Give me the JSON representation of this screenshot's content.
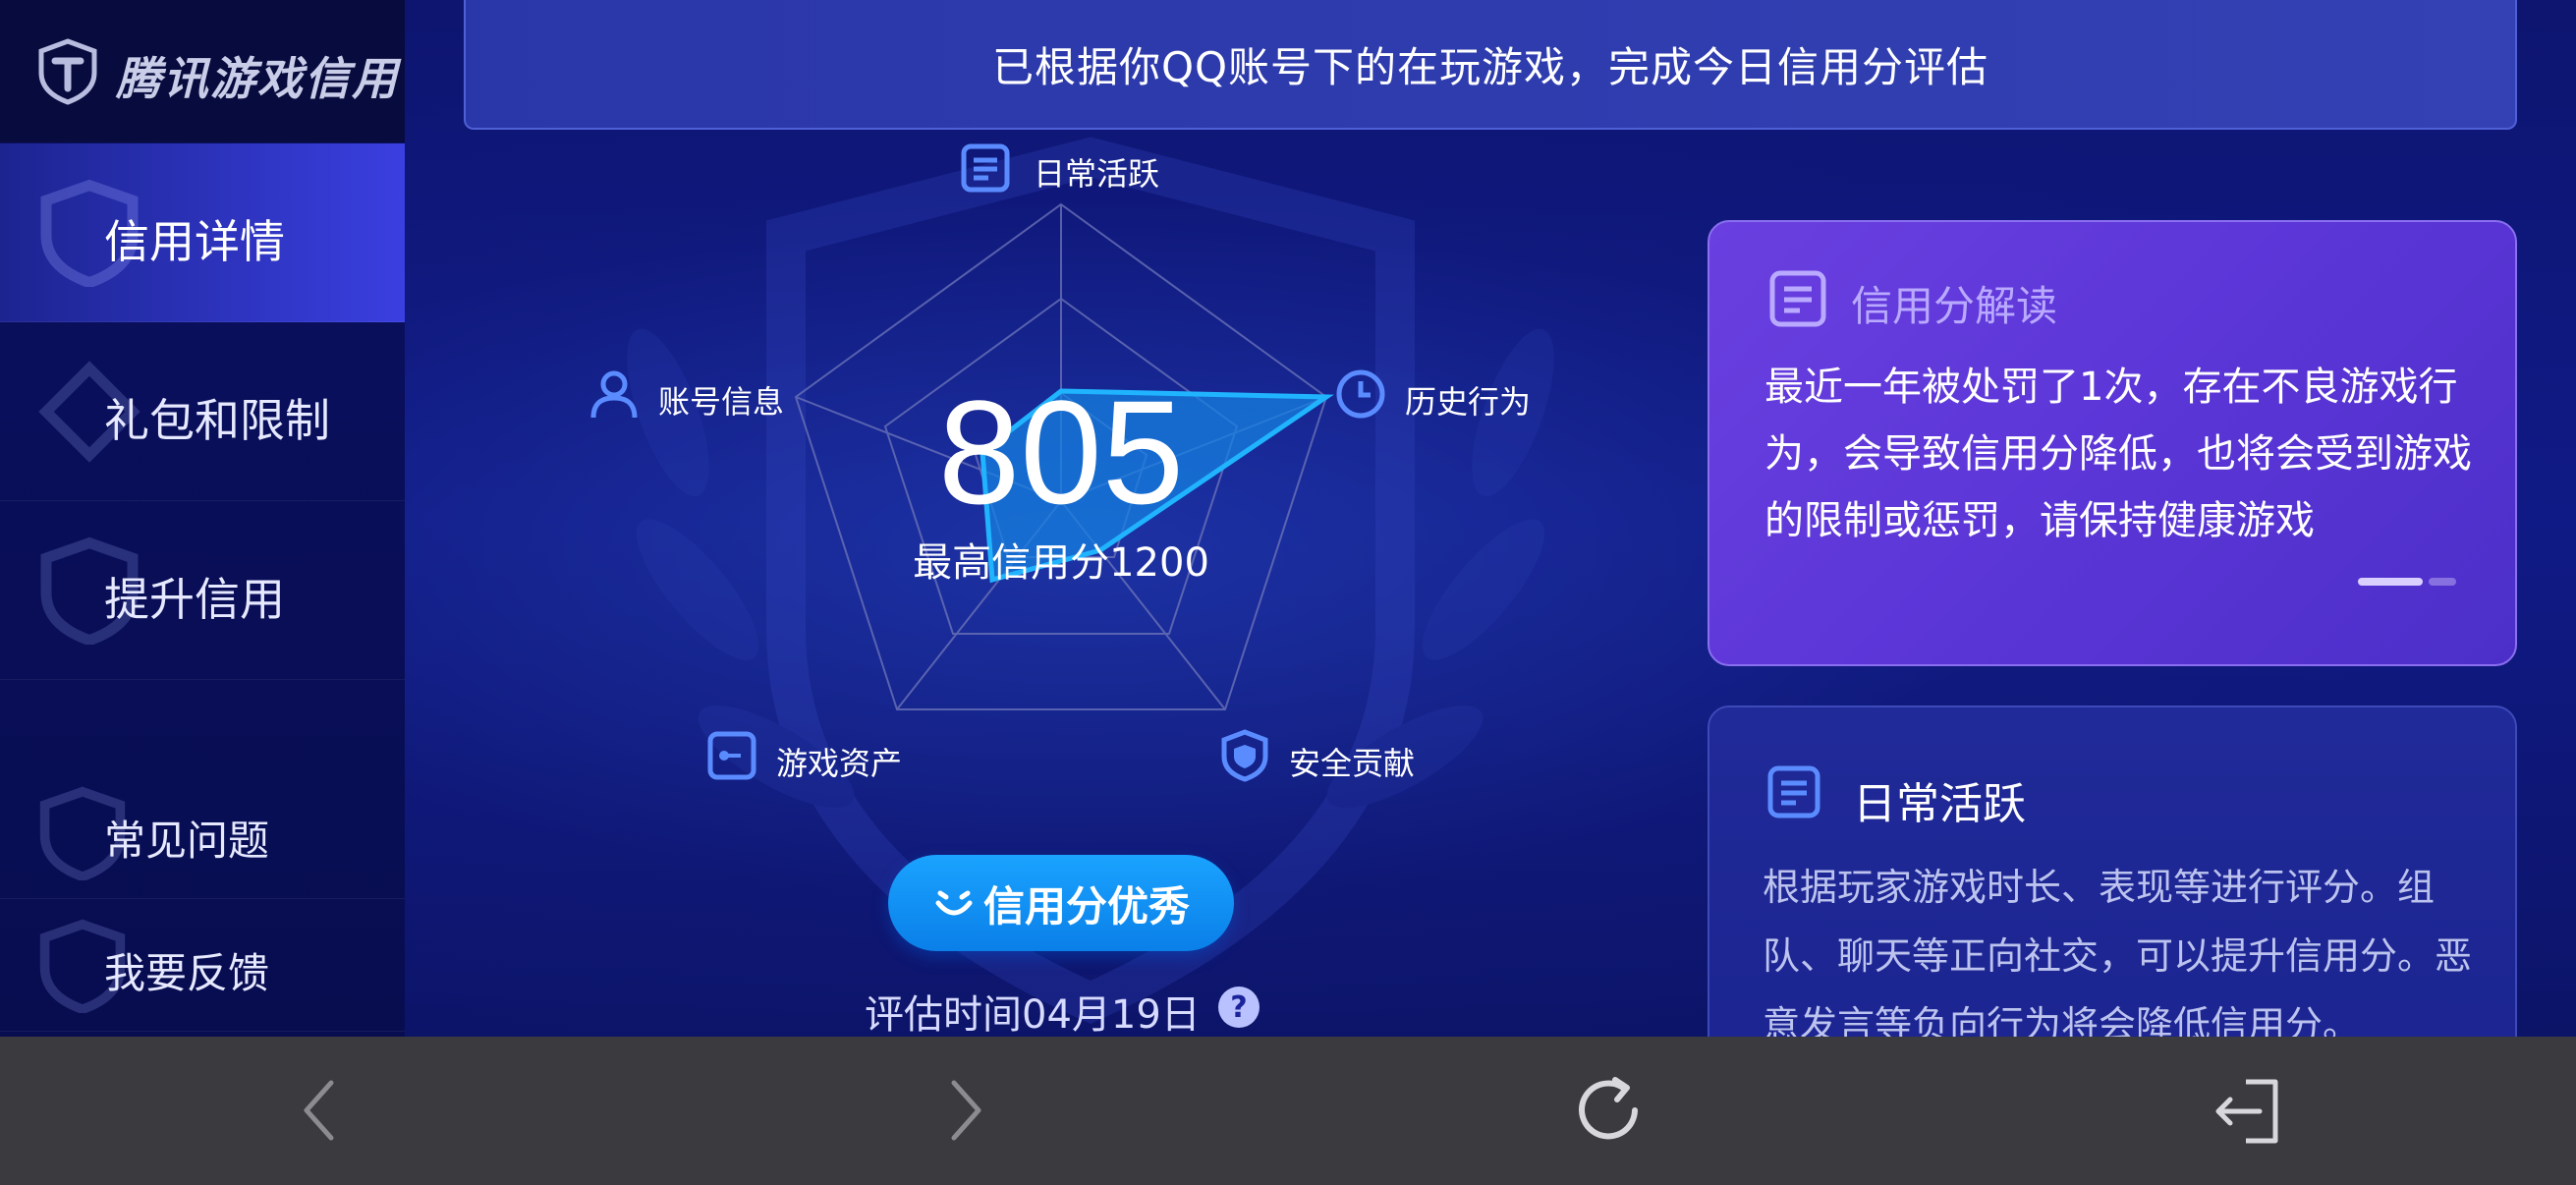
{
  "brand": {
    "name": "腾讯游戏信用"
  },
  "sidebar": {
    "items": [
      {
        "label": "信用详情",
        "active": true
      },
      {
        "label": "礼包和限制",
        "active": false
      },
      {
        "label": "提升信用",
        "active": false
      },
      {
        "label": "常见问题",
        "active": false
      },
      {
        "label": "我要反馈",
        "active": false
      }
    ]
  },
  "banner": {
    "text": "已根据你QQ账号下的在玩游戏，完成今日信用分评估"
  },
  "radar": {
    "axes": [
      {
        "label": "日常活跃",
        "icon": "document-icon"
      },
      {
        "label": "历史行为",
        "icon": "clock-icon"
      },
      {
        "label": "安全贡献",
        "icon": "shield-icon"
      },
      {
        "label": "游戏资产",
        "icon": "key-icon"
      },
      {
        "label": "账号信息",
        "icon": "user-icon"
      }
    ],
    "score": "805",
    "max_score": "最高信用分1200",
    "colors": {
      "fill": "#1680e0",
      "stroke": "#20b4ff",
      "grid": "#6a72b8"
    }
  },
  "rating": {
    "label": "信用分优秀",
    "icon": "smile-icon"
  },
  "evaluation": {
    "time": "评估时间04月19日",
    "help": "?"
  },
  "interpret_card": {
    "title": "信用分解读",
    "body": "最近一年被处罚了1次，存在不良游戏行为，会导致信用分降低，也将会受到游戏的限制或惩罚，请保持健康游戏"
  },
  "daily_card": {
    "title": "日常活跃",
    "body": "根据玩家游戏时长、表现等进行评分。组队、聊天等正向社交，可以提升信用分。恶意发言等负向行为将会降低信用分。"
  },
  "bottom_bar": {
    "icons": [
      "back-icon",
      "forward-icon",
      "refresh-icon",
      "exit-icon"
    ]
  }
}
